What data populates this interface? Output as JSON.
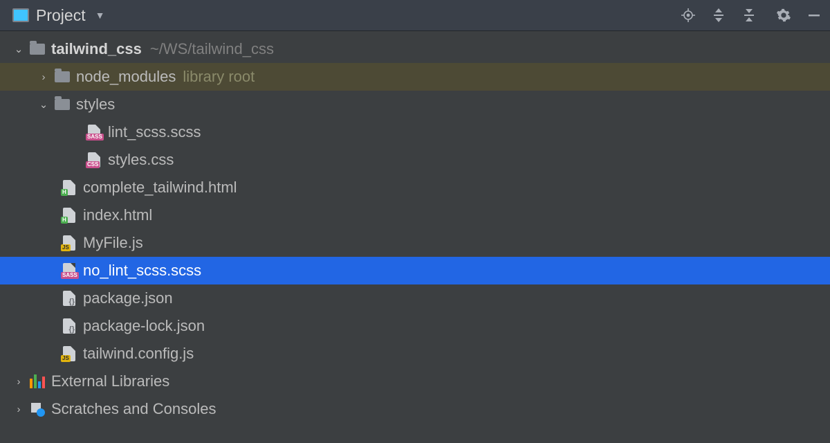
{
  "header": {
    "title": "Project"
  },
  "tree": {
    "root": {
      "name": "tailwind_css",
      "path": "~/WS/tailwind_css"
    },
    "node_modules": {
      "name": "node_modules",
      "hint": "library root"
    },
    "styles": {
      "name": "styles"
    },
    "files": {
      "lint_scss": "lint_scss.scss",
      "styles_css": "styles.css",
      "complete_tailwind": "complete_tailwind.html",
      "index_html": "index.html",
      "myfile_js": "MyFile.js",
      "no_lint_scss": "no_lint_scss.scss",
      "package_json": "package.json",
      "package_lock": "package-lock.json",
      "tailwind_config": "tailwind.config.js"
    },
    "external_libraries": "External Libraries",
    "scratches": "Scratches and Consoles"
  }
}
